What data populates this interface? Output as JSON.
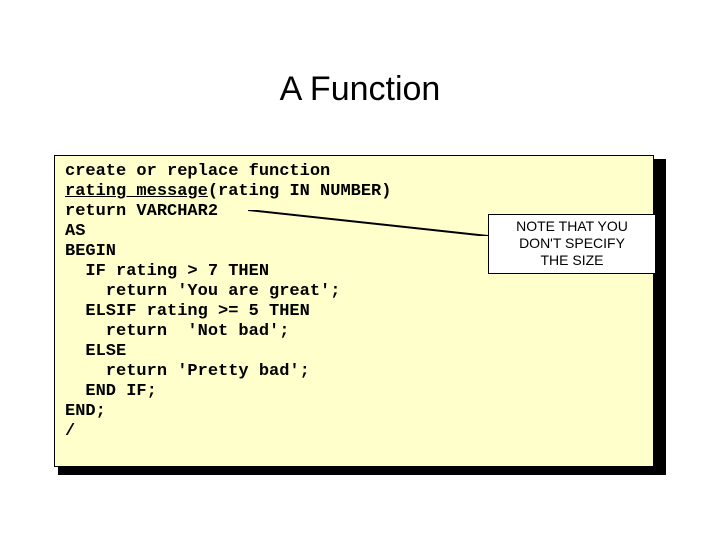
{
  "title": "A Function",
  "code": {
    "l1": "create or replace function",
    "l2a": "rating_message",
    "l2b": "(rating IN NUMBER)",
    "l3": "return VARCHAR2",
    "l4": "AS",
    "l5": "BEGIN",
    "l6": "  IF rating > 7 THEN",
    "l7": "    return 'You are great';",
    "l8": "  ELSIF rating >= 5 THEN",
    "l9": "    return  'Not bad';",
    "l10": "  ELSE",
    "l11": "    return 'Pretty bad';",
    "l12": "  END IF;",
    "l13": "END;",
    "l14": "/"
  },
  "note": {
    "line1": "NOTE THAT YOU",
    "line2": "DON'T SPECIFY",
    "line3": "THE SIZE"
  }
}
